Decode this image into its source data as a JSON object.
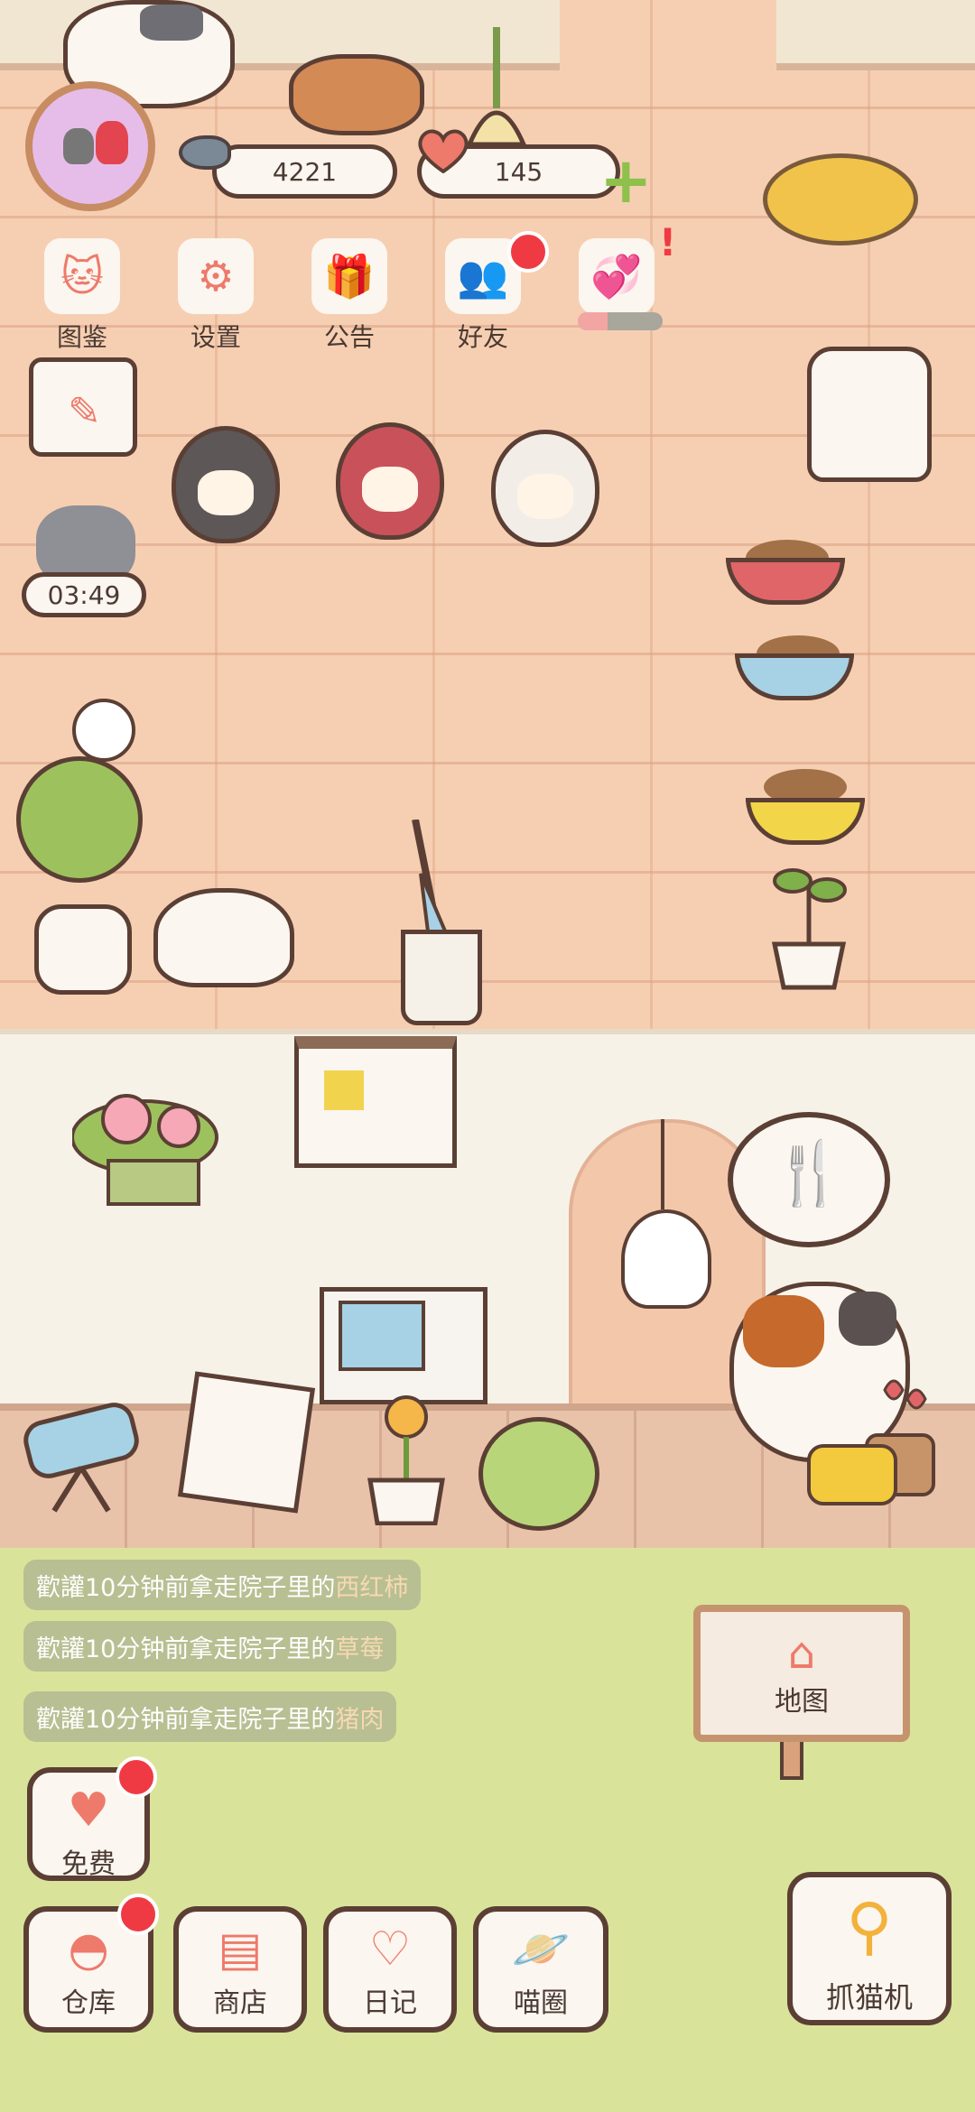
{
  "hud": {
    "coins": "4221",
    "hearts": "145",
    "timer": "03:49",
    "love_progress": 0.35
  },
  "top_menu": {
    "guide": "图鉴",
    "settings": "设置",
    "notice": "公告",
    "friends": "好友"
  },
  "notifications": [
    {
      "name": "歡讙",
      "text": "10分钟前拿走院子里的",
      "item": "西红柿"
    },
    {
      "name": "歡讙",
      "text": "10分钟前拿走院子里的",
      "item": "草莓"
    },
    {
      "name": "歡讙",
      "text": "10分钟前拿走院子里的",
      "item": "猪肉"
    }
  ],
  "map_sign": {
    "label": "地图"
  },
  "bottom_menu": {
    "free": "免费",
    "storage": "仓库",
    "shop": "商店",
    "diary": "日记",
    "meow_circle": "喵圈",
    "claw_machine": "抓猫机"
  },
  "icons": {
    "guide": "cat-head-icon",
    "settings": "gear-icon",
    "notice": "gift-icon",
    "friends": "friends-icon",
    "love": "heart-hands-icon",
    "map": "house-icon",
    "food_bubble": "fork-knife-icon"
  },
  "colors": {
    "accent": "#ee7a6b",
    "badge_red": "#ef3a44",
    "outline": "#5b3f35",
    "grass": "#d9e49a",
    "plus_green": "#8dc14c"
  }
}
